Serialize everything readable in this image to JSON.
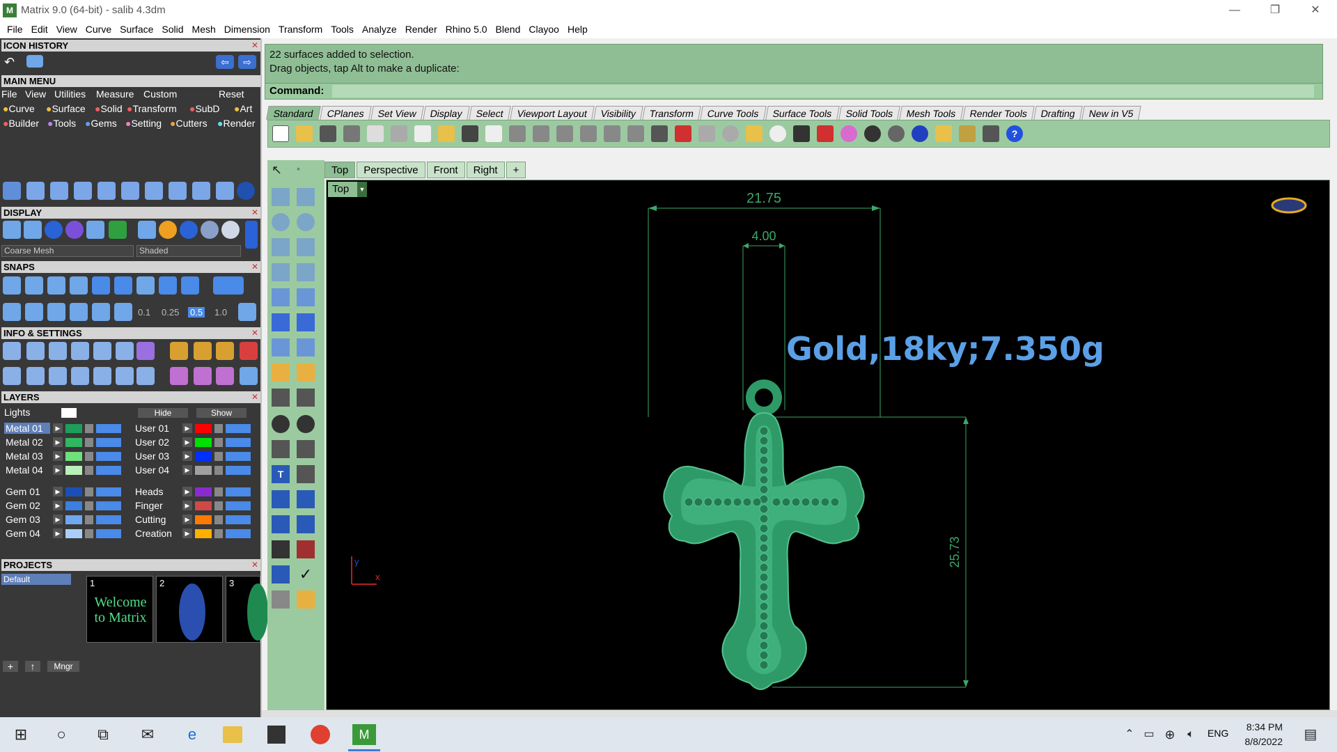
{
  "window": {
    "title": "Matrix 9.0 (64-bit) - salib 4.3dm",
    "minimize": "—",
    "maximize": "❐",
    "close": "✕"
  },
  "menubar": [
    "File",
    "Edit",
    "View",
    "Curve",
    "Surface",
    "Solid",
    "Mesh",
    "Dimension",
    "Transform",
    "Tools",
    "Analyze",
    "Render",
    "Rhino 5.0",
    "Blend",
    "Clayoo",
    "Help"
  ],
  "left_panel": {
    "icon_history": {
      "title": "ICON HISTORY"
    },
    "main_menu": {
      "title": "MAIN MENU",
      "row1": [
        "File",
        "View",
        "Utilities",
        "Measure",
        "Custom"
      ],
      "reset": "Reset",
      "row2": [
        "Curve",
        "Surface",
        "Solid",
        "Transform",
        "SubD",
        "Art"
      ],
      "row3": [
        "Builder",
        "Tools",
        "Gems",
        "Setting",
        "Cutters",
        "Render"
      ]
    },
    "display": {
      "title": "DISPLAY",
      "mesh_select": "Coarse Mesh",
      "shade_select": "Shaded"
    },
    "snaps": {
      "title": "SNAPS",
      "values": [
        "0.1",
        "0.25",
        "0.5",
        "1.0"
      ]
    },
    "info_settings": {
      "title": "INFO & SETTINGS"
    },
    "layers": {
      "title": "LAYERS",
      "lights": "Lights",
      "hide": "Hide",
      "show": "Show",
      "left_col": [
        {
          "name": "Metal 01",
          "color": "#1e9e5a",
          "selected": true
        },
        {
          "name": "Metal 02",
          "color": "#2fb860"
        },
        {
          "name": "Metal 03",
          "color": "#6fe07a"
        },
        {
          "name": "Metal 04",
          "color": "#b8f0b8"
        },
        {
          "name": "Gem 01",
          "color": "#1b4fb8"
        },
        {
          "name": "Gem 02",
          "color": "#3b7fe0"
        },
        {
          "name": "Gem 03",
          "color": "#6fa7f0"
        },
        {
          "name": "Gem 04",
          "color": "#a9cff8"
        }
      ],
      "right_col": [
        {
          "name": "User 01",
          "color": "#ff0000"
        },
        {
          "name": "User 02",
          "color": "#00e000"
        },
        {
          "name": "User 03",
          "color": "#0030ff"
        },
        {
          "name": "User 04",
          "color": "#a0a0a0"
        },
        {
          "name": "Heads",
          "color": "#8a2bd0"
        },
        {
          "name": "Finger",
          "color": "#d04848"
        },
        {
          "name": "Cutting",
          "color": "#ff7a00"
        },
        {
          "name": "Creation",
          "color": "#ffb000"
        }
      ]
    },
    "projects": {
      "title": "PROJECTS",
      "default": "Default",
      "thumbs": [
        {
          "num": "1",
          "text": "Welcome to Matrix"
        },
        {
          "num": "2",
          "text": ""
        },
        {
          "num": "3",
          "text": ""
        }
      ],
      "mngr": "Mngr"
    }
  },
  "command": {
    "line1": "22 surfaces added to selection.",
    "line2": "Drag objects, tap Alt to make a duplicate:",
    "label": "Command:",
    "value": ""
  },
  "toolbar_tabs": [
    "Standard",
    "CPlanes",
    "Set View",
    "Display",
    "Select",
    "Viewport Layout",
    "Visibility",
    "Transform",
    "Curve Tools",
    "Surface Tools",
    "Solid Tools",
    "Mesh Tools",
    "Render Tools",
    "Drafting",
    "New in V5"
  ],
  "viewport_tabs": [
    "Top",
    "Perspective",
    "Front",
    "Right",
    "+"
  ],
  "viewport": {
    "label": "Top",
    "dim_width": "21.75",
    "dim_bail": "4.00",
    "dim_height": "25.73",
    "annotation": "Gold,18ky;7.350g",
    "axis_y": "y",
    "axis_x": "x"
  },
  "taskbar": {
    "lang": "ENG",
    "time": "8:34 PM",
    "date": "8/8/2022"
  }
}
